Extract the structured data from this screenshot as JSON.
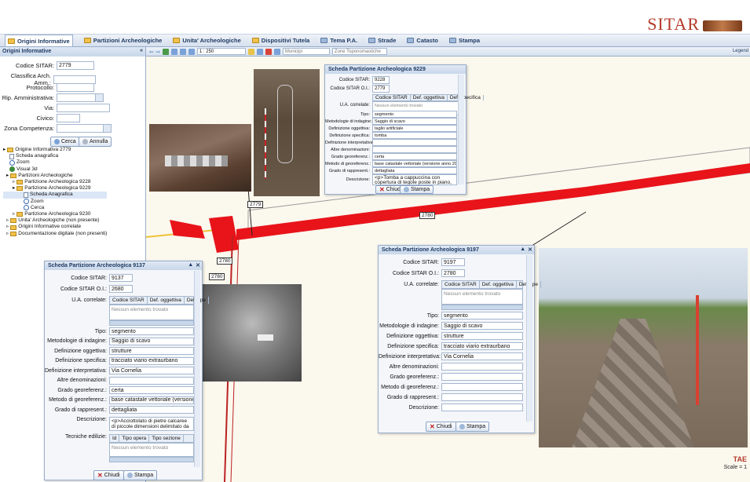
{
  "header": {
    "logo_text": "SITAR"
  },
  "tabs": [
    {
      "label": "Origini Informative",
      "icon": "folder-icon"
    },
    {
      "label": "Partizioni Archeologiche",
      "icon": "folder-icon"
    },
    {
      "label": "Unita' Archeologiche",
      "icon": "folder-icon"
    },
    {
      "label": "Dispositivi Tutela",
      "icon": "folder-icon"
    },
    {
      "label": "Tema P.A.",
      "icon": "layers-icon"
    },
    {
      "label": "Strade",
      "icon": "layers-icon"
    },
    {
      "label": "Catasto",
      "icon": "layers-icon"
    },
    {
      "label": "Stampa",
      "icon": "print-icon"
    }
  ],
  "sidebar": {
    "title": "Origini Informative",
    "fields": {
      "codice_sitar_label": "Codice SITAR:",
      "codice_sitar_value": "2779",
      "classifica_label": "Classifica Arch. Amm.:",
      "protocollo_label": "Protocollo:",
      "rip_label": "Rip. Amministrativa:",
      "via_label": "Via:",
      "civico_label": "Civico:",
      "zona_label": "Zona Competenza:"
    },
    "cerca": "Cerca",
    "annulla": "Annulla",
    "tree": [
      {
        "label": "Origine Informativa 2779",
        "level": 0,
        "icon": "folder"
      },
      {
        "label": "Scheda anagrafica",
        "level": 1,
        "icon": "doc"
      },
      {
        "label": "Zoom",
        "level": 1,
        "icon": "mag"
      },
      {
        "label": "Visual 3d",
        "level": 1,
        "icon": "globe"
      },
      {
        "label": "Partizioni Archeologiche",
        "level": 1,
        "icon": "folder"
      },
      {
        "label": "Partizione Archeologica 9228",
        "level": 2,
        "icon": "folder"
      },
      {
        "label": "Partizione Archeologica 9229",
        "level": 2,
        "icon": "folder"
      },
      {
        "label": "Scheda Anagrafica",
        "level": 3,
        "icon": "doc",
        "selected": true
      },
      {
        "label": "Zoom",
        "level": 3,
        "icon": "mag"
      },
      {
        "label": "Cerca",
        "level": 3,
        "icon": "mag"
      },
      {
        "label": "Partizione Archeologica 9230",
        "level": 2,
        "icon": "folder"
      },
      {
        "label": "Unita' Archeologiche (non presente)",
        "level": 1,
        "icon": "folder"
      },
      {
        "label": "Origini Informative correlate",
        "level": 1,
        "icon": "folder"
      },
      {
        "label": "Documentazione digitale (non presenti)",
        "level": 1,
        "icon": "folder"
      }
    ]
  },
  "map_toolbar": {
    "scale": "1 : 250",
    "municipi_placeholder": "Municipi",
    "zone_placeholder": "Zone Toponomastiche",
    "legend": "Legend"
  },
  "map_labels": {
    "l1": "2779",
    "l2": "2780",
    "l3": "2780",
    "l4": "2780"
  },
  "win_top": {
    "title": "Scheda Partizione Archeologica 9229",
    "codice_sitar": "9228",
    "codice_oi": "2779",
    "subtabs": [
      "Codice SITAR",
      "Def. oggettiva",
      "Def. specifica"
    ],
    "empty": "Nessun elemento trovato",
    "rows": [
      {
        "label": "Tipo:",
        "value": "segmento"
      },
      {
        "label": "Metodologie di indagine:",
        "value": "Saggio di scavo"
      },
      {
        "label": "Definizione oggettiva:",
        "value": "taglio artificiale"
      },
      {
        "label": "Definizione specifica:",
        "value": "tomba"
      },
      {
        "label": "Definizione interpretativa:",
        "value": ""
      },
      {
        "label": "Altre denominazioni:",
        "value": ""
      },
      {
        "label": "Grado georeferenz.:",
        "value": "certa"
      },
      {
        "label": "Metodo di georeferenz.:",
        "value": "base catastale vettoriale (versione anno 2004)"
      },
      {
        "label": "Grado di rappresent.:",
        "value": "dettagliata"
      }
    ],
    "descrizione_label": "Descrizione:",
    "descrizione": "<p>Tomba a cappuccina con copertura di tegole poste in piano, di cui una recante un bollo a",
    "chiudi": "Chiudi",
    "stampa": "Stampa"
  },
  "win_left": {
    "title": "Scheda Partizione Archeologica 9137",
    "codice_sitar_label": "Codice SITAR:",
    "codice_sitar": "9137",
    "codice_oi_label": "Codice SITAR O.I.:",
    "codice_oi": "2680",
    "ua_label": "U.A. correlate:",
    "subtabs": [
      "Codice SITAR",
      "Def. oggettiva",
      "Def. spe"
    ],
    "empty": "Nessun elemento trovato",
    "rows": [
      {
        "label": "Tipo:",
        "value": "segmento"
      },
      {
        "label": "Metodologie di indagine:",
        "value": "Saggio di scavo"
      },
      {
        "label": "Definizione oggettiva:",
        "value": "strutture"
      },
      {
        "label": "Definizione specifica:",
        "value": "tracciato viario extraurbano"
      },
      {
        "label": "Definizione interpretativa:",
        "value": "Via Cornelia"
      },
      {
        "label": "Altre denominazioni:",
        "value": ""
      },
      {
        "label": "Grado georeferenz.:",
        "value": "certa"
      },
      {
        "label": "Metodo di georeferenz.:",
        "value": "base catastale vettoriale (versione anr"
      },
      {
        "label": "Grado di rappresent.:",
        "value": "dettagliata"
      }
    ],
    "descrizione_label": "Descrizione:",
    "descrizione": "<p>Acciottolato di pietre calcaree di piccole dimensioni delimitato da",
    "tecniche_label": "Tecniche edilizie:",
    "tecniche_cols": [
      "Id",
      "Tipo opera",
      "Tipo sezione"
    ],
    "tecniche_empty": "Nessun elemento trovato",
    "chiudi": "Chiudi",
    "stampa": "Stampa"
  },
  "win_right": {
    "title": "Scheda Partizione Archeologica 9197",
    "codice_sitar_label": "Codice SITAR:",
    "codice_sitar": "9197",
    "codice_oi_label": "Codice SITAR O.I.:",
    "codice_oi": "2780",
    "ua_label": "U.A. correlate:",
    "subtabs": [
      "Codice SITAR",
      "Def. oggettiva",
      "Def. spe"
    ],
    "empty": "Nessun elemento trovato",
    "rows": [
      {
        "label": "Tipo:",
        "value": "segmento"
      },
      {
        "label": "Metodologie di indagine:",
        "value": "Saggio di scavo"
      },
      {
        "label": "Definizione oggettiva:",
        "value": "strutture"
      },
      {
        "label": "Definizione specifica:",
        "value": "tracciato viario extraurbano"
      },
      {
        "label": "Definizione interpretativa:",
        "value": "Via Cornelia"
      },
      {
        "label": "Altre denominazioni:",
        "value": ""
      },
      {
        "label": "Grado georeferenz.:",
        "value": ""
      },
      {
        "label": "Metodo di georeferenz.:",
        "value": ""
      },
      {
        "label": "Grado di rappresent.:",
        "value": ""
      },
      {
        "label": "Descrizione:",
        "value": ""
      }
    ],
    "chiudi": "Chiudi",
    "stampa": "Stampa"
  },
  "footer": {
    "tae": "TAE",
    "scale": "Scale = 1"
  },
  "colors": {
    "accent": "#1e3a62",
    "map_red": "#e8141a",
    "map_bg": "#fbf8ee",
    "road_yellow": "#f0c23a",
    "logo": "#b23a2a"
  }
}
